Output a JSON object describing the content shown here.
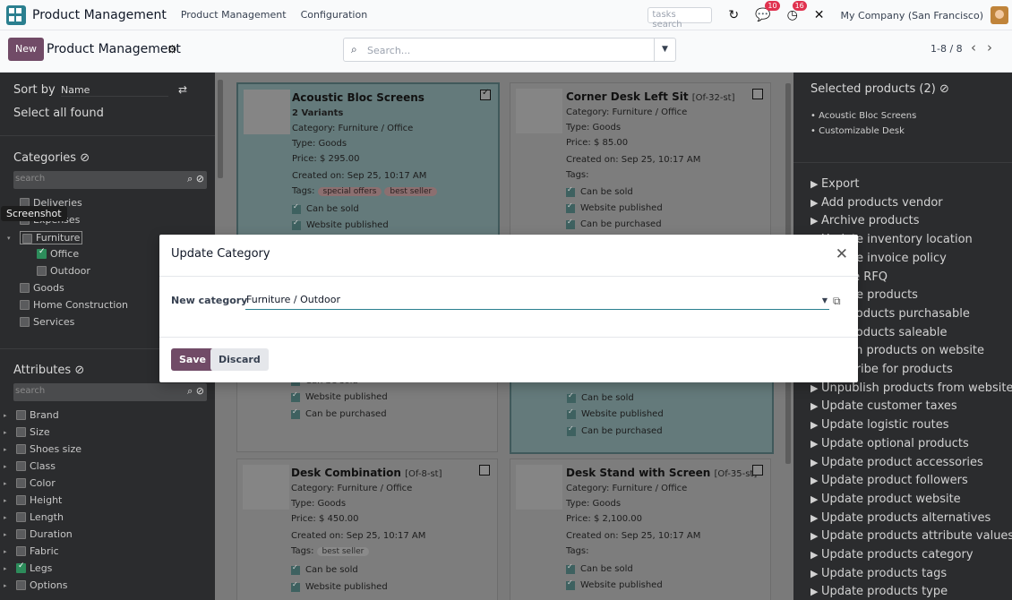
{
  "navbar": {
    "app_name": "Product Management",
    "menus": [
      "Product Management",
      "Configuration"
    ],
    "tasks_search_placeholder": "tasks search",
    "messages_count": "10",
    "activities_count": "16",
    "company": "My Company (San Francisco)"
  },
  "control": {
    "new_label": "New",
    "title": "Product Management",
    "search_placeholder": "Search...",
    "pager": "1-8 / 8"
  },
  "left": {
    "sort_by_label": "Sort by",
    "sort_value": "Name",
    "select_all_label": "Select all found",
    "categories_title": "Categories",
    "categories_search": "search",
    "categories": [
      {
        "label": "Deliveries",
        "checked": false
      },
      {
        "label": "Expenses",
        "checked": false
      },
      {
        "label": "Furniture",
        "checked": false
      },
      {
        "label": "Office",
        "checked": true
      },
      {
        "label": "Outdoor",
        "checked": false
      },
      {
        "label": "Goods",
        "checked": false
      },
      {
        "label": "Home Construction",
        "checked": false
      },
      {
        "label": "Services",
        "checked": false
      }
    ],
    "tooltip": "Screenshot",
    "attributes_title": "Attributes",
    "attributes_search": "search",
    "attributes": [
      "Brand",
      "Size",
      "Shoes size",
      "Class",
      "Color",
      "Height",
      "Length",
      "Duration",
      "Fabric",
      "Legs",
      "Options"
    ]
  },
  "cards": [
    {
      "name": "Acoustic Bloc Screens",
      "ref": "",
      "variants": "2 Variants",
      "category": "Category: Furniture / Office",
      "type": "Type: Goods",
      "price": "Price: $ 295.00",
      "created": "Created on: Sep 25, 10:17 AM",
      "tags_label": "Tags:",
      "tags": [
        "special offers",
        "best seller"
      ],
      "opts": [
        "Can be sold",
        "Website published"
      ],
      "selected": true
    },
    {
      "name": "Corner Desk Left Sit",
      "ref": "[Of-32-st]",
      "category": "Category: Furniture / Office",
      "type": "Type: Goods",
      "price": "Price: $ 85.00",
      "created": "Created on: Sep 25, 10:17 AM",
      "tags_label": "Tags:",
      "opts": [
        "Can be sold",
        "Website published",
        "Can be purchased"
      ],
      "selected": false
    },
    {
      "opts": [
        "Can be sold",
        "Website published",
        "Can be purchased"
      ]
    },
    {
      "opts": [
        "Can be sold",
        "Website published",
        "Can be purchased"
      ]
    },
    {
      "name": "Desk Combination",
      "ref": "[Of-8-st]",
      "category": "Category: Furniture / Office",
      "type": "Type: Goods",
      "price": "Price: $ 450.00",
      "created": "Created on: Sep 25, 10:17 AM",
      "tags_label": "Tags:",
      "tags": [
        "best seller"
      ],
      "opts": [
        "Can be sold",
        "Website published"
      ],
      "selected": false
    },
    {
      "name": "Desk Stand with Screen",
      "ref": "[Of-35-st]",
      "category": "Category: Furniture / Office",
      "type": "Type: Goods",
      "price": "Price: $ 2,100.00",
      "created": "Created on: Sep 25, 10:17 AM",
      "tags_label": "Tags:",
      "opts": [
        "Can be sold",
        "Website published"
      ],
      "selected": false
    }
  ],
  "right": {
    "selected_title": "Selected products (2)",
    "selected_items": [
      "Acoustic Bloc Screens",
      "Customizable Desk"
    ],
    "actions": [
      "Export",
      "Add products vendor",
      "Archive products",
      "Update inventory location",
      "Update invoice policy",
      "Create RFQ",
      "Update products",
      "Set products purchasable",
      "Set products saleable",
      "Publish products on website",
      "Subscribe for products",
      "Unpublish products from website",
      "Update customer taxes",
      "Update logistic routes",
      "Update optional products",
      "Update product accessories",
      "Update product followers",
      "Update product website",
      "Update products alternatives",
      "Update products attribute values",
      "Update products category",
      "Update products tags",
      "Update products type"
    ]
  },
  "modal": {
    "title": "Update Category",
    "field_label": "New category",
    "field_value": "Furniture / Outdoor",
    "save_label": "Save",
    "discard_label": "Discard"
  }
}
